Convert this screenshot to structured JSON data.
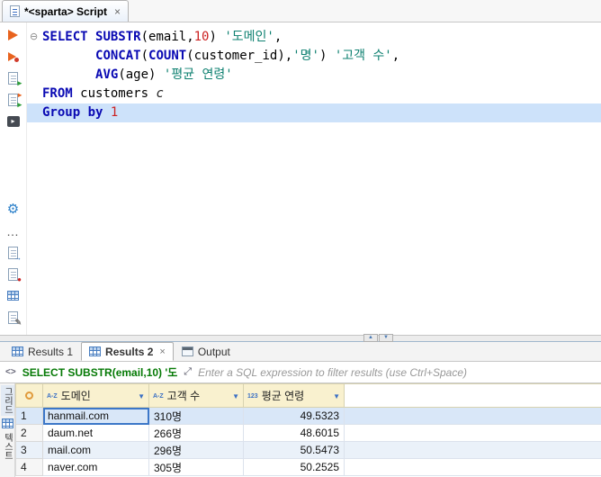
{
  "editor": {
    "tab_label": "*<sparta> Script",
    "lines": [
      {
        "fold": true,
        "selected": false,
        "tokens": [
          {
            "c": "kw",
            "t": "SELECT"
          },
          {
            "c": "pl",
            "t": " "
          },
          {
            "c": "kw",
            "t": "SUBSTR"
          },
          {
            "c": "pl",
            "t": "("
          },
          {
            "c": "id",
            "t": "email"
          },
          {
            "c": "pl",
            "t": ","
          },
          {
            "c": "num",
            "t": "10"
          },
          {
            "c": "pl",
            "t": ") "
          },
          {
            "c": "str",
            "t": "'도메인'"
          },
          {
            "c": "pl",
            "t": ","
          }
        ]
      },
      {
        "fold": false,
        "selected": false,
        "tokens": [
          {
            "c": "pl",
            "t": "       "
          },
          {
            "c": "kw",
            "t": "CONCAT"
          },
          {
            "c": "pl",
            "t": "("
          },
          {
            "c": "kw",
            "t": "COUNT"
          },
          {
            "c": "pl",
            "t": "("
          },
          {
            "c": "id",
            "t": "customer_id"
          },
          {
            "c": "pl",
            "t": "),"
          },
          {
            "c": "str",
            "t": "'명'"
          },
          {
            "c": "pl",
            "t": ") "
          },
          {
            "c": "str",
            "t": "'고객 수'"
          },
          {
            "c": "pl",
            "t": ","
          }
        ]
      },
      {
        "fold": false,
        "selected": false,
        "tokens": [
          {
            "c": "pl",
            "t": "       "
          },
          {
            "c": "kw",
            "t": "AVG"
          },
          {
            "c": "pl",
            "t": "("
          },
          {
            "c": "id",
            "t": "age"
          },
          {
            "c": "pl",
            "t": ") "
          },
          {
            "c": "str",
            "t": "'평균 연령'"
          }
        ]
      },
      {
        "fold": false,
        "selected": false,
        "tokens": [
          {
            "c": "kw",
            "t": "FROM"
          },
          {
            "c": "pl",
            "t": " "
          },
          {
            "c": "id",
            "t": "customers"
          },
          {
            "c": "pl",
            "t": " "
          },
          {
            "c": "alias",
            "t": "c"
          }
        ]
      },
      {
        "fold": false,
        "selected": true,
        "tokens": [
          {
            "c": "kw",
            "t": "Group by"
          },
          {
            "c": "pl",
            "t": " "
          },
          {
            "c": "num",
            "t": "1"
          }
        ]
      }
    ],
    "toolbar_icons": [
      "execute-statement",
      "execute-new-tab",
      "execute-script",
      "execute-script-new-tab",
      "open-sql-console",
      "settings-gear",
      "more",
      "export-result",
      "stop-document",
      "open-grid",
      "edit-document",
      "log"
    ]
  },
  "splitter": {
    "up_glyph": "▲",
    "down_glyph": "▼"
  },
  "results": {
    "tabs": [
      {
        "label": "Results 1",
        "active": false
      },
      {
        "label": "Results 2",
        "active": true
      },
      {
        "label": "Output",
        "active": false
      }
    ],
    "filter": {
      "icon_text": "<>",
      "query": "SELECT SUBSTR(email,10) '도",
      "placeholder": "Enter a SQL expression to filter results (use Ctrl+Space)"
    },
    "side_tabs": [
      {
        "label": "그리드",
        "active": true
      },
      {
        "label": "텍스트",
        "active": false
      }
    ],
    "grid": {
      "columns": [
        {
          "icon": "A-Z",
          "label": "도메인"
        },
        {
          "icon": "A-Z",
          "label": "고객 수"
        },
        {
          "icon": "123",
          "label": "평균 연령"
        }
      ],
      "rows": [
        [
          "hanmail.com",
          "310명",
          "49.5323"
        ],
        [
          "daum.net",
          "266명",
          "48.6015"
        ],
        [
          "mail.com",
          "296명",
          "50.5473"
        ],
        [
          "naver.com",
          "305명",
          "50.2525"
        ]
      ],
      "selected_cell": {
        "row": 0,
        "col": 0
      }
    }
  },
  "colors": {
    "keyword": "#0909b3",
    "string": "#0e8070",
    "number": "#cc2222",
    "selected_line_bg": "#cde2fa",
    "header_bg": "#f9f1cf",
    "row_stripe": "#eaf1f9",
    "selected_row": "#d9e7f8",
    "accent_blue": "#3c77c8",
    "filter_query_green": "#067a06",
    "play_orange": "#e8631e"
  }
}
